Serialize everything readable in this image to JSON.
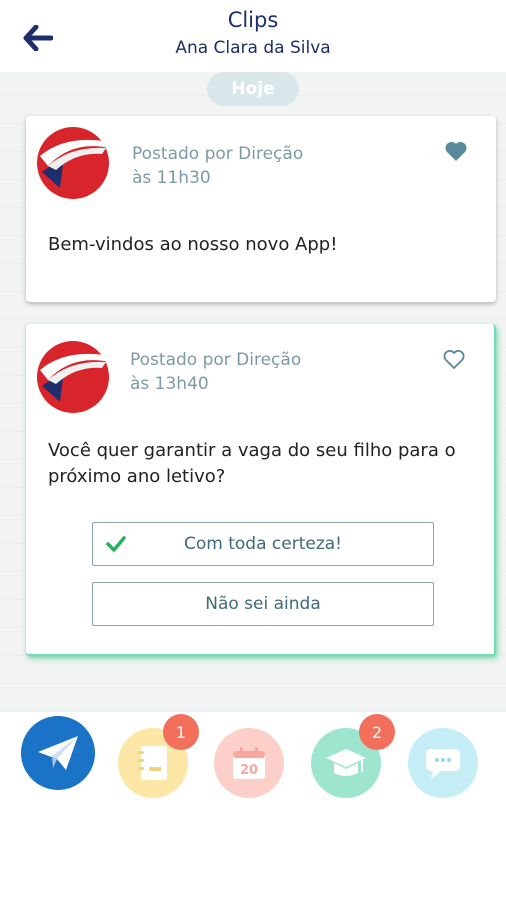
{
  "header": {
    "title": "Clips",
    "subtitle": "Ana Clara da Silva",
    "back_icon": "arrow-left-icon"
  },
  "feed": {
    "date_label": "Hoje",
    "posts": [
      {
        "author": "Postado por Direção",
        "time": "às 11h30",
        "message": "Bem-vindos ao nosso novo App!",
        "liked": true
      },
      {
        "author": "Postado por Direção",
        "time": "às 13h40",
        "message": "Você quer garantir a vaga do seu filho para o próximo ano letivo?",
        "liked": false,
        "options": [
          {
            "label": "Com toda certeza!",
            "selected": true
          },
          {
            "label": "Não sei ainda",
            "selected": false
          }
        ]
      }
    ]
  },
  "bottom_nav": {
    "items": [
      {
        "icon": "send-icon",
        "color": "#1b73c7"
      },
      {
        "icon": "notebook-icon",
        "color": "#fde7a6",
        "badge": "1"
      },
      {
        "icon": "calendar-icon",
        "color": "#fcd0c8",
        "calendar_day": "20"
      },
      {
        "icon": "graduation-cap-icon",
        "color": "#9ee5cf",
        "badge": "2"
      },
      {
        "icon": "chat-icon",
        "color": "#c5edf6"
      }
    ]
  },
  "colors": {
    "primary_text": "#1d2f6b",
    "meta_text": "#7b9aa6",
    "heart": "#5a8a99",
    "check": "#27ae60",
    "badge": "#f26f5c",
    "accent_border": "#6de0b3"
  }
}
